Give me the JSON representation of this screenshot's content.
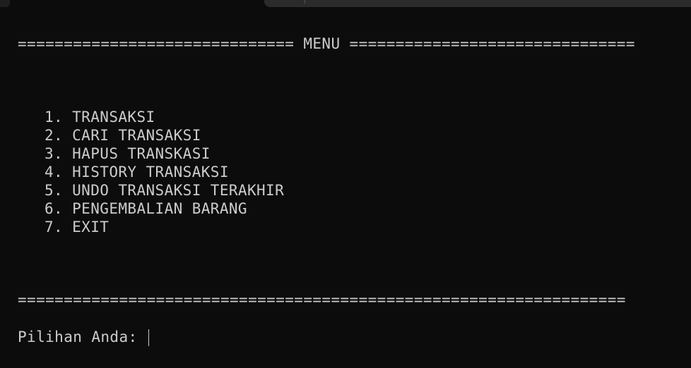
{
  "header_rule": "============================== MENU ===============================",
  "menu": {
    "items": [
      {
        "number": "1.",
        "label": "TRANSAKSI"
      },
      {
        "number": "2.",
        "label": "CARI TRANSAKSI"
      },
      {
        "number": "3.",
        "label": "HAPUS TRANSKASI"
      },
      {
        "number": "4.",
        "label": "HISTORY TRANSAKSI"
      },
      {
        "number": "5.",
        "label": "UNDO TRANSAKSI TERAKHIR"
      },
      {
        "number": "6.",
        "label": "PENGEMBALIAN BARANG"
      },
      {
        "number": "7.",
        "label": "EXIT"
      }
    ]
  },
  "footer_rule": "==================================================================",
  "prompt": {
    "label": "Pilihan Anda: "
  },
  "colors": {
    "background": "#0c0c0c",
    "text": "#cccccc"
  }
}
